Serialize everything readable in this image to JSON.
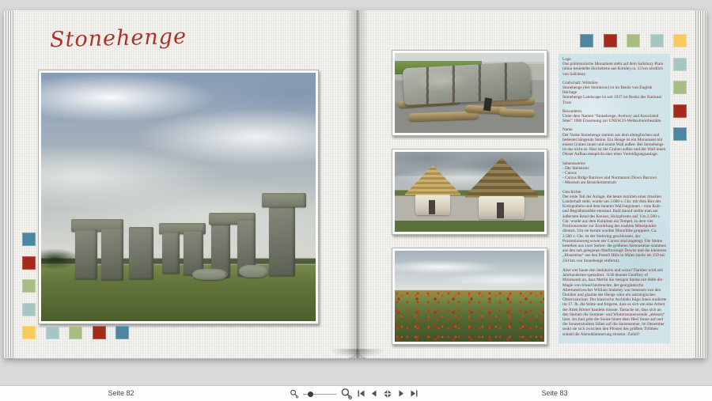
{
  "app_background": "#d9d9d9",
  "palette": {
    "teal": "#4d86a0",
    "red": "#a52a1c",
    "green": "#a9bc85",
    "light_blue": "#a7c6c3",
    "yellow": "#f7ca5f"
  },
  "book": {
    "left_page": {
      "title": "Stonehenge",
      "title_color": "#ad3124",
      "main_photo": {
        "name": "stonehenge-stone-circle",
        "description": "Stonehenge stone circle under a cloudy sky with green meadow"
      },
      "accent_sequence_vertical": [
        "teal",
        "red",
        "green",
        "light_blue",
        "yellow"
      ],
      "accent_sequence_bottom": [
        "yellow",
        "light_blue",
        "green",
        "red",
        "teal"
      ]
    },
    "right_page": {
      "accent_sequence_top": [
        "teal",
        "red",
        "green",
        "light_blue",
        "yellow"
      ],
      "accent_sequence_right": [
        "yellow",
        "light_blue",
        "green",
        "red",
        "teal"
      ],
      "photos": [
        {
          "name": "sarsen-stone-sledge",
          "description": "Sarsen stone lashed with ropes onto a wooden sledge with log rollers"
        },
        {
          "name": "neolithic-huts",
          "description": "Reconstructed Neolithic huts with white walls and thatched roofs"
        },
        {
          "name": "poppy-field",
          "description": "Green field scattered with red poppies under a cloudy sky"
        }
      ],
      "info_panel": {
        "background": "#cfe3e9",
        "text_color": "#7d2d1e",
        "sections": [
          {
            "heading": "Lage",
            "body": "Das prähistorische Monument steht auf dem Salisbury Plain (dünn besiedelte Hochebene aus Kreide) ca. 13 km nördlich von Salisbury."
          },
          {
            "heading": "Grafschaft: Wiltshire",
            "body": "Stonehenge (der Steinkreis) ist im Besitz von English Heritage\nStonehenge Landscape ist seit 1927 im Besitz des National Trust"
          },
          {
            "heading": "Besonderes",
            "body": "Unter dem Namen “Stonehenge, Avebury and Associated Sites” 1986 Ernennung zur UNESCO-Weltkulturerbestätte."
          },
          {
            "heading": "Name",
            "body": "Der Name Stonehenge stammt aus dem altenglischen und bedeutet hängende Steine. Ein Henge ist ein Monument mit einem Graben innen und einem Wall außen. Bei Stonehenge ist das nicht so. Hier ist der Graben außen und der Wall innen. Dieser Aufbau entspricht eher einer Verteidigungsanlage."
          },
          {
            "heading": "Sehenswertes",
            "body": "- Der Steinkreis\n- Cursus\n- Cursus Ridge Barrows und Normanton Down Barrows\n- Museum am Besucherzentrum"
          },
          {
            "heading": "Geschichte",
            "body": "Der erste Teil der Anlage, die heute inmitten einer rituellen Landschaft steht, wurde um 3.000 v. Chr. mit dem Bau des Kreisgrabens und dem inneren Wall begonnen – eine Kult- und Begräbnisstätte entstand. Bald darauf stellte man am äußersten Rand des Kreises, Holzpfosten auf. Um 2.500 v. Chr. wurde aus dem Kultplatz ein Tempel, in dem vier Positionssteine zur Ermittlung des exakten Mittelpunkts dienten. Um sie herum wurden Monolithe gruppiert. Ca. 2.500 v. Chr. ist der Steinring geschlossen, der Prozessionsweg sowie der Cursus sind angelegt. Die Steine bestehen aus zwei Sorten: die größeren Sarsensteine stammen aus den nah gelegenen Marlborough Downs und die kleineren „Blausteine“ aus den Preseli Hills in Wales (mehr als 150 mi/ 250 km von Stonehenge entfernt).\n\nAber wer baute den Steinkreis und wozu? Darüber wird seit Jahrhunderten spekuliert. 1136 deutete Geoffrey of Monmouth an, dass Merlin die riesigen Steine mit Hilfe der Magie von Irland hierbrachte, der georgianische Altertumsforscher William Stukeley war besessen von den Druiden und glaubte der Henge wäre ein astrologisches Observatorium. Der klassische Architekt Inigo Jones studierte im 17. Jh. die Stätte und folgerte, dass es sich um eine Arbeit der Alten Römer handeln müsste. Tatsache ist, dass sich an den Steinen die Sommer- und Wintersonnenwende „ablesen“ lässt. Im Juni geht die Sonne hinter dem Heel Stone auf und die Sonnenstrahlen fallen auf die Sarsensteine, im Dezember senkt sie sich zwischen den Pfosten des größten Trilithen sobald die Abenddämmerung einsetzt. Zufall?"
          }
        ]
      }
    }
  },
  "toolbar": {
    "left_page_label": "Seite 82",
    "right_page_label": "Seite 83",
    "icons": [
      "zoom-out-icon",
      "zoom-slider",
      "zoom-in-icon",
      "first-page-icon",
      "previous-page-icon",
      "fit-page-icon",
      "next-page-icon",
      "last-page-icon"
    ]
  }
}
